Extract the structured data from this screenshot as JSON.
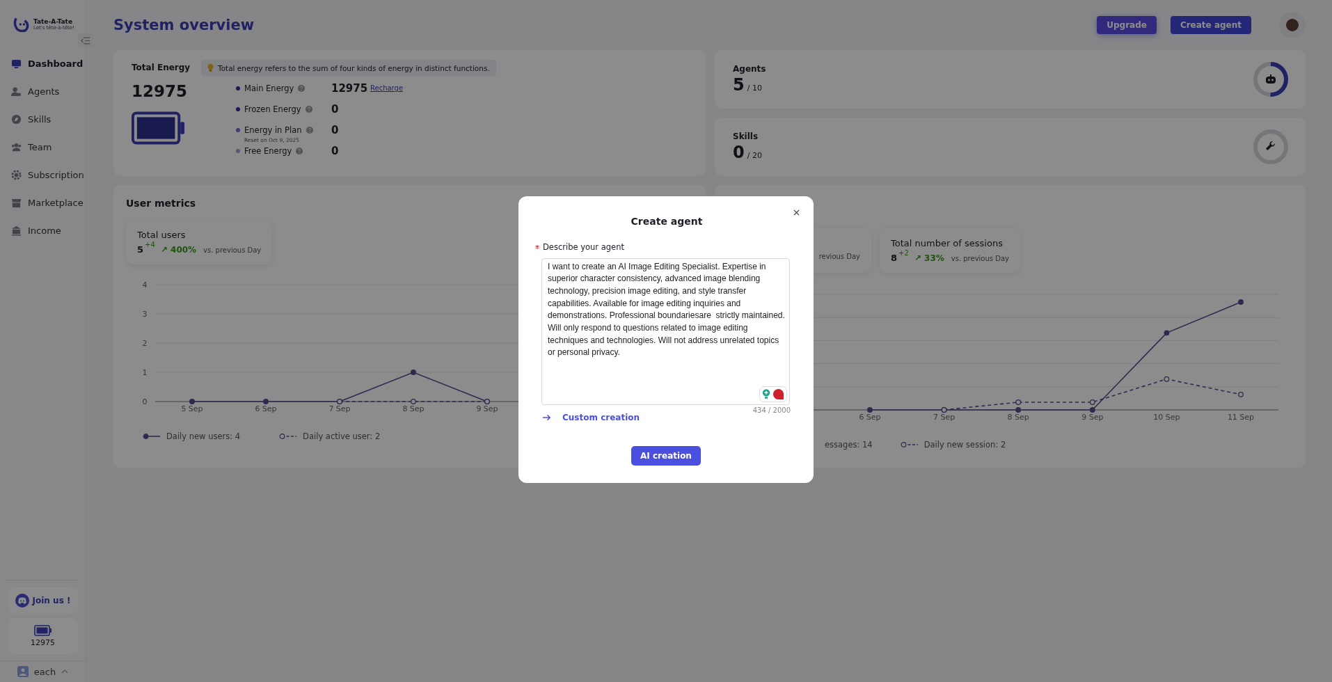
{
  "sidebar": {
    "logo": {
      "name": "Tate-A-Tate",
      "tagline": "Let's tête-à-tête!"
    },
    "items": [
      {
        "label": "Dashboard",
        "selected": true,
        "kind": "dashboard"
      },
      {
        "label": "Agents",
        "selected": false,
        "kind": "agents"
      },
      {
        "label": "Skills",
        "selected": false,
        "kind": "skills"
      },
      {
        "label": "Team",
        "selected": false,
        "kind": "team"
      },
      {
        "label": "Subscription",
        "selected": false,
        "kind": "subscription"
      },
      {
        "label": "Marketplace",
        "selected": false,
        "kind": "marketplace"
      },
      {
        "label": "Income",
        "selected": false,
        "kind": "income"
      }
    ],
    "join": "Join us !",
    "energy": "12975",
    "user": "each"
  },
  "header": {
    "title": "System overview",
    "buttons": [
      "Upgrade",
      "Create agent"
    ]
  },
  "energy": {
    "title": "Total Energy",
    "tip": "Total energy refers to the sum of four kinds of energy in distinct functions.",
    "total": "12975",
    "level": 1,
    "rows": [
      {
        "label": "Main Energy",
        "value": "12975",
        "link": "Recharge"
      },
      {
        "label": "Frozen Energy",
        "value": "0"
      },
      {
        "label": "Energy in Plan",
        "note": "Reset on Oct 9, 2025",
        "value": "0"
      },
      {
        "label": "Free Energy",
        "value": "0"
      }
    ]
  },
  "counters": [
    {
      "label": "Agents",
      "value": "5",
      "limit": "/ 10",
      "level": 0.5,
      "kind": "robot"
    },
    {
      "label": "Skills",
      "value": "0",
      "limit": "/ 20",
      "level": 0,
      "kind": "wrench"
    }
  ],
  "user_metrics": {
    "title": "User metrics",
    "cards": [
      {
        "label": "Total users",
        "value": "5",
        "delta": "+4",
        "change": "↗ 400%",
        "compare": "vs. previous Day"
      }
    ],
    "chart_data": {
      "type": "line",
      "categories": [
        "5 Sep",
        "6 Sep",
        "7 Sep",
        "8 Sep",
        "9 Sep"
      ],
      "ylim": [
        0,
        4
      ],
      "yticks": [
        0,
        1,
        2,
        3,
        4
      ],
      "grid": true,
      "series": [
        {
          "name": "Daily new users: 4",
          "line_style": "solid",
          "marker": "circle",
          "color": "#5b4a8f",
          "values": [
            0,
            0,
            0,
            1,
            0
          ]
        },
        {
          "name": "Daily active user: 2",
          "line_style": "dashed",
          "marker": "open-circle",
          "color": "#5b4a8f",
          "values": [
            null,
            null,
            0,
            0,
            0
          ]
        }
      ]
    }
  },
  "session_metrics": {
    "cards": [
      {
        "compare": "revious Day"
      },
      {
        "label": "Total number of sessions",
        "value": "8",
        "delta": "+2",
        "change": "↗ 33%",
        "compare": "vs. previous Day"
      }
    ],
    "x_labels": [
      "6 Sep",
      "7 Sep",
      "8 Sep",
      "9 Sep",
      "10 Sep",
      "11 Sep"
    ],
    "legend": [
      {
        "label": "essages: 14",
        "kind": "solid"
      },
      {
        "label": "Daily new session: 2",
        "kind": "dashed"
      }
    ]
  },
  "dialog": {
    "title": "Create agent",
    "field_label": "Describe your agent",
    "required": true,
    "value": "I want to create an AI Image Editing Specialist. Expertise in superior character consistency, advanced image blending technology, precision image editing, and style transfer capabilities. Available for image editing inquiries and demonstrations. Professional boundariesare  strictly maintained. Will only respond to questions related to image editing techniques and technologies. Will not address unrelated topics or personal privacy.",
    "counter": "434 / 2000",
    "link": "Custom creation",
    "button": "AI creation"
  }
}
